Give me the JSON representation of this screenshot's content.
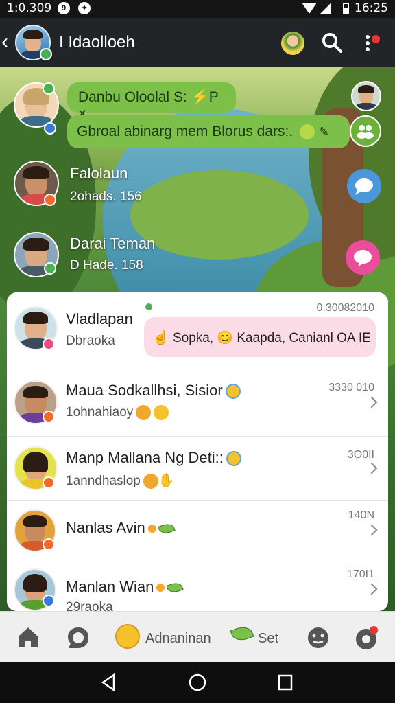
{
  "statusbar": {
    "time": "1:0.309",
    "icon1": "9",
    "right_time": "16:25"
  },
  "header": {
    "title": "I Idaolloeh"
  },
  "pinned": [
    {
      "text": "Danbu Oloolal S: ⚡P ×"
    },
    {
      "text": "Gbroal abinarg mem Blorus dars:."
    }
  ],
  "chats_top": [
    {
      "name": "Falolaun",
      "sub": "2ohads. 156"
    },
    {
      "name": "Darai Teman",
      "sub": "D Hade. 158"
    }
  ],
  "list": [
    {
      "name": "Vladlapan",
      "preview": "Dbraoka",
      "time": "0.30082010",
      "bubble": "Sopka, 😊 Kaapda, Canianl OA IE"
    },
    {
      "name": "Maua Sodkallhsi, Sisior",
      "preview": "1ohnahiaoy",
      "time": "3330 010"
    },
    {
      "name": "Manp Mallana Ng Deti::",
      "preview": "1anndhaslop",
      "time": "3O0II"
    },
    {
      "name": "Nanlas Avin",
      "preview": "",
      "time": "140N"
    },
    {
      "name": "Manlan Wian",
      "preview": "29raoka",
      "time": "170I1"
    }
  ],
  "bottomnav": {
    "label_a": "Adnaninan",
    "label_b": "Set"
  },
  "colors": {
    "accent_green": "#7cc04a",
    "header_bg": "#222528",
    "pink_bubble": "#fbdbe6",
    "blue_action": "#4a97d9",
    "pink_action": "#ea4e9b"
  },
  "icons": [
    "back-icon",
    "search-icon",
    "more-icon",
    "group-icon",
    "chat-bubble-icon",
    "home-icon",
    "chat-icon",
    "sticker-icon",
    "leaf-icon",
    "face-icon",
    "camera-icon",
    "back-triangle-icon",
    "home-circle-icon",
    "recents-square-icon"
  ]
}
